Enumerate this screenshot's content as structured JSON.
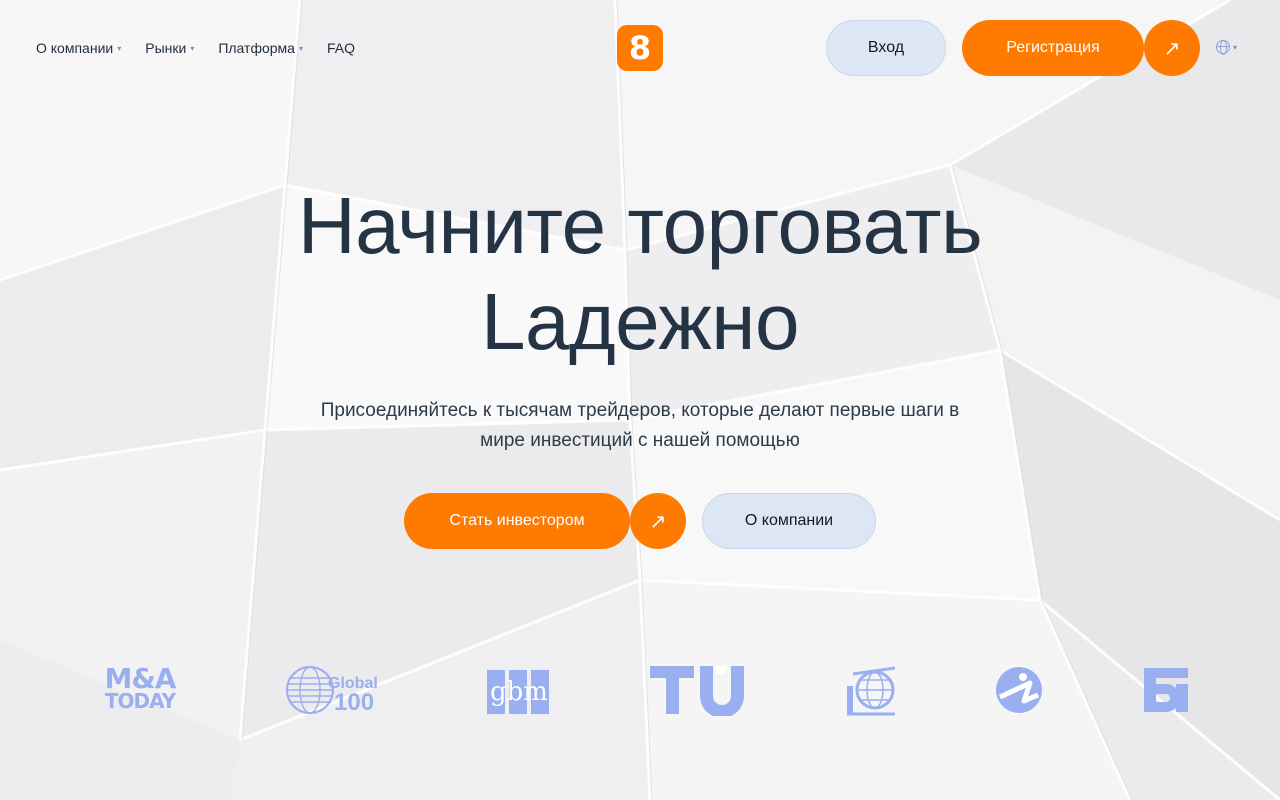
{
  "nav": {
    "links": [
      {
        "label": "О компании",
        "has_dropdown": true
      },
      {
        "label": "Рынки",
        "has_dropdown": true
      },
      {
        "label": "Платформа",
        "has_dropdown": true
      },
      {
        "label": "FAQ",
        "has_dropdown": false
      }
    ],
    "logo_glyph": "8",
    "login_label": "Вход",
    "register_label": "Регистрация"
  },
  "hero": {
    "title_line1": "Начните торговать",
    "title_line2": "Lадежно",
    "subtitle_line1": "Присоединяйтесь к тысячам трейдеров, которые делают первые шаги в",
    "subtitle_line2": "мире инвестиций с нашей помощью",
    "cta_primary": "Стать инвестором",
    "cta_secondary": "О компании"
  },
  "partners": {
    "ma_line1": "M&A",
    "ma_line2": "TODAY",
    "global_line1": "Global",
    "global_line2": "100",
    "gbm": "gbm"
  },
  "colors": {
    "accent": "#ff7a00",
    "secondary_button": "#dde6f5",
    "heading": "#253445",
    "partner_logo": "#9aaff0"
  },
  "icons": {
    "arrow": "arrow-up-right-icon",
    "dropdown": "chevron-down-icon",
    "language": "globe-icon"
  }
}
